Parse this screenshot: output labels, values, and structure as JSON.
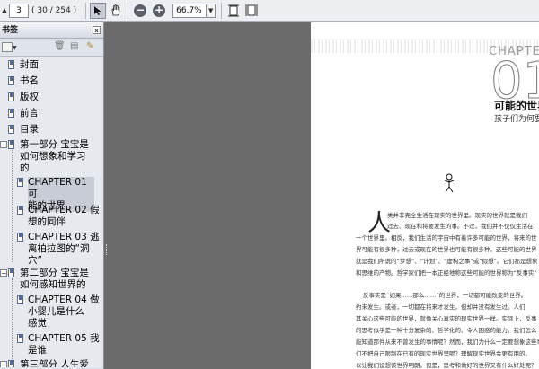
{
  "toolbar": {
    "page_current": "3",
    "page_count": "( 30 / 254 )",
    "zoom": "66.7%"
  },
  "sidebar": {
    "title": "书签",
    "close": "x",
    "items": [
      {
        "label": "封面"
      },
      {
        "label": "书名"
      },
      {
        "label": "版权"
      },
      {
        "label": "前言"
      },
      {
        "label": "目录"
      },
      {
        "label_lines": [
          "第一部分  宝宝是",
          "如何想象和学习",
          "的"
        ]
      },
      {
        "label_lines": [
          "CHAPTER 01  可",
          "能的世界"
        ]
      },
      {
        "label_lines": [
          "CHAPTER 02  假",
          "想的同伴"
        ]
      },
      {
        "label_lines": [
          "CHAPTER 03  逃",
          "离柏拉图的“洞",
          "穴”"
        ]
      },
      {
        "label_lines": [
          "第二部分  宝宝是",
          "如何感知世界的"
        ]
      },
      {
        "label_lines": [
          "CHAPTER 04  做",
          "小婴儿是什么",
          "感觉"
        ]
      },
      {
        "label_lines": [
          "CHAPTER 05  我",
          "是谁"
        ]
      },
      {
        "label_lines": [
          "第三部分  人生爱"
        ]
      }
    ]
  },
  "page": {
    "chapter_word": "CHAPTER",
    "chapter_num": "01",
    "chapter_title": "可能的世界",
    "chapter_sub": "孩子们为何要假",
    "dropcap": "人",
    "lines": [
      "类并非完全生活在现实的世界里。现实的世界就是我们",
      "过去、现在和将要发生的事。不过，我们并不仅仅生活在",
      "一个世界里。相反，我们生活的宇宙中有着许多可能的世界，将来的世",
      "界可能有很多种，过去或现在的世界也可能有很多种。这些可能的世界",
      "就是我们所说的“梦想”、“计划”、“虚构之事”或“假想”。它们都是想象",
      "和思维的产物。哲学家们把一本正经地称这些可能的世界称为“反事实”",
      "",
      "反事实是“如果……那么……”的世界，一切都可能改变的世界。",
      "约未发生。或者，一切都在将来才发生，但却并没有发生过。人们",
      "其关心这些可能的世界，就像关心真实的现实世界一样。实际上，反事",
      "的思考似乎是一种十分复杂的、哲学化的、令人困惑的能力。我们怎么",
      "能知道那件从来不曾发生的事情呢？然而，我们为什么一定要想象这些事",
      "们不把自己限制在已有的现实世界里呢？理解现实世界会更有用的。",
      "以让我们设想该世界明朗。但是，思考和做好的世界又有什么好处呢？"
    ]
  }
}
